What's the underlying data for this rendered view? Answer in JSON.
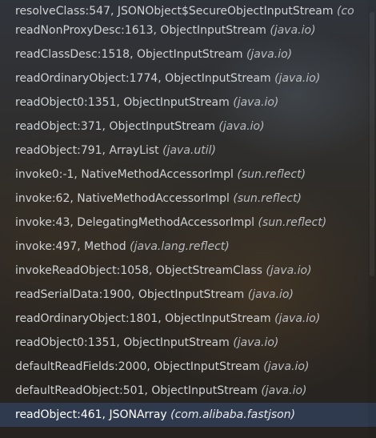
{
  "frames": [
    {
      "method": "resolveClass:547, JSONObject$SecureObjectInputStream",
      "pkg": "(co"
    },
    {
      "method": "readNonProxyDesc:1613, ObjectInputStream",
      "pkg": "(java.io)"
    },
    {
      "method": "readClassDesc:1518, ObjectInputStream",
      "pkg": "(java.io)"
    },
    {
      "method": "readOrdinaryObject:1774, ObjectInputStream",
      "pkg": "(java.io)"
    },
    {
      "method": "readObject0:1351, ObjectInputStream",
      "pkg": "(java.io)"
    },
    {
      "method": "readObject:371, ObjectInputStream",
      "pkg": "(java.io)"
    },
    {
      "method": "readObject:791, ArrayList",
      "pkg": "(java.util)"
    },
    {
      "method": "invoke0:-1, NativeMethodAccessorImpl",
      "pkg": "(sun.reflect)"
    },
    {
      "method": "invoke:62, NativeMethodAccessorImpl",
      "pkg": "(sun.reflect)"
    },
    {
      "method": "invoke:43, DelegatingMethodAccessorImpl",
      "pkg": "(sun.reflect)"
    },
    {
      "method": "invoke:497, Method",
      "pkg": "(java.lang.reflect)"
    },
    {
      "method": "invokeReadObject:1058, ObjectStreamClass",
      "pkg": "(java.io)"
    },
    {
      "method": "readSerialData:1900, ObjectInputStream",
      "pkg": "(java.io)"
    },
    {
      "method": "readOrdinaryObject:1801, ObjectInputStream",
      "pkg": "(java.io)"
    },
    {
      "method": "readObject0:1351, ObjectInputStream",
      "pkg": "(java.io)"
    },
    {
      "method": "defaultReadFields:2000, ObjectInputStream",
      "pkg": "(java.io)"
    },
    {
      "method": "defaultReadObject:501, ObjectInputStream",
      "pkg": "(java.io)"
    },
    {
      "method": "readObject:461, JSONArray",
      "pkg": "(com.alibaba.fastjson)"
    }
  ],
  "selected_frame_index": 17,
  "colors": {
    "selected_background": "#2f3a4e",
    "text": "#c7c9cc"
  }
}
